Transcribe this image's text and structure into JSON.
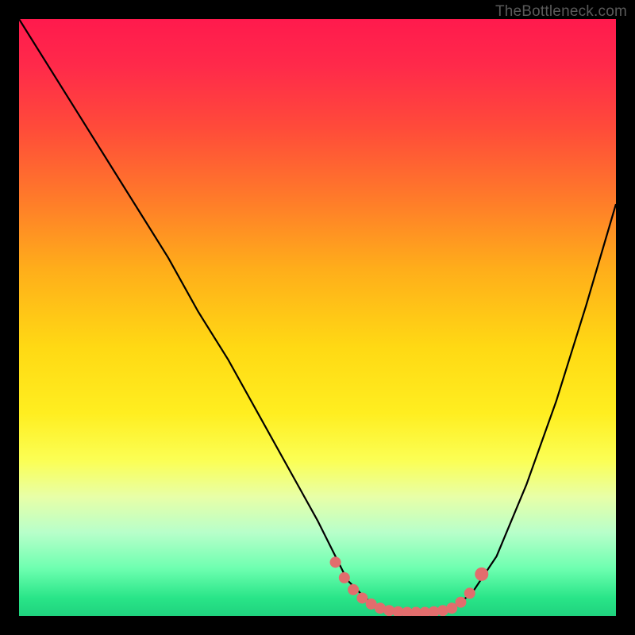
{
  "watermark": {
    "text": "TheBottleneck.com"
  },
  "chart_data": {
    "type": "line",
    "title": "",
    "xlabel": "",
    "ylabel": "",
    "xlim": [
      0,
      100
    ],
    "ylim": [
      0,
      100
    ],
    "series": [
      {
        "name": "curve",
        "x": [
          0,
          5,
          10,
          15,
          20,
          25,
          30,
          35,
          40,
          45,
          50,
          53,
          55,
          58,
          60,
          63,
          65,
          67,
          70,
          73,
          76,
          80,
          85,
          90,
          95,
          100
        ],
        "values": [
          100,
          92,
          84,
          76,
          68,
          60,
          51,
          43,
          34,
          25,
          16,
          10,
          6,
          3,
          1.5,
          0.8,
          0.6,
          0.6,
          0.8,
          1.5,
          4,
          10,
          22,
          36,
          52,
          69
        ]
      }
    ],
    "markers": [
      {
        "x": 53.0,
        "y": 9.0
      },
      {
        "x": 54.5,
        "y": 6.4
      },
      {
        "x": 56.0,
        "y": 4.4
      },
      {
        "x": 57.5,
        "y": 3.0
      },
      {
        "x": 59.0,
        "y": 2.0
      },
      {
        "x": 60.5,
        "y": 1.3
      },
      {
        "x": 62.0,
        "y": 0.9
      },
      {
        "x": 63.5,
        "y": 0.7
      },
      {
        "x": 65.0,
        "y": 0.6
      },
      {
        "x": 66.5,
        "y": 0.6
      },
      {
        "x": 68.0,
        "y": 0.6
      },
      {
        "x": 69.5,
        "y": 0.7
      },
      {
        "x": 71.0,
        "y": 0.9
      },
      {
        "x": 72.5,
        "y": 1.3
      },
      {
        "x": 74.0,
        "y": 2.3
      },
      {
        "x": 75.5,
        "y": 3.8
      },
      {
        "x": 77.5,
        "y": 7.0
      }
    ],
    "colors": {
      "line": "#000000",
      "marker": "#e26d6d"
    }
  }
}
